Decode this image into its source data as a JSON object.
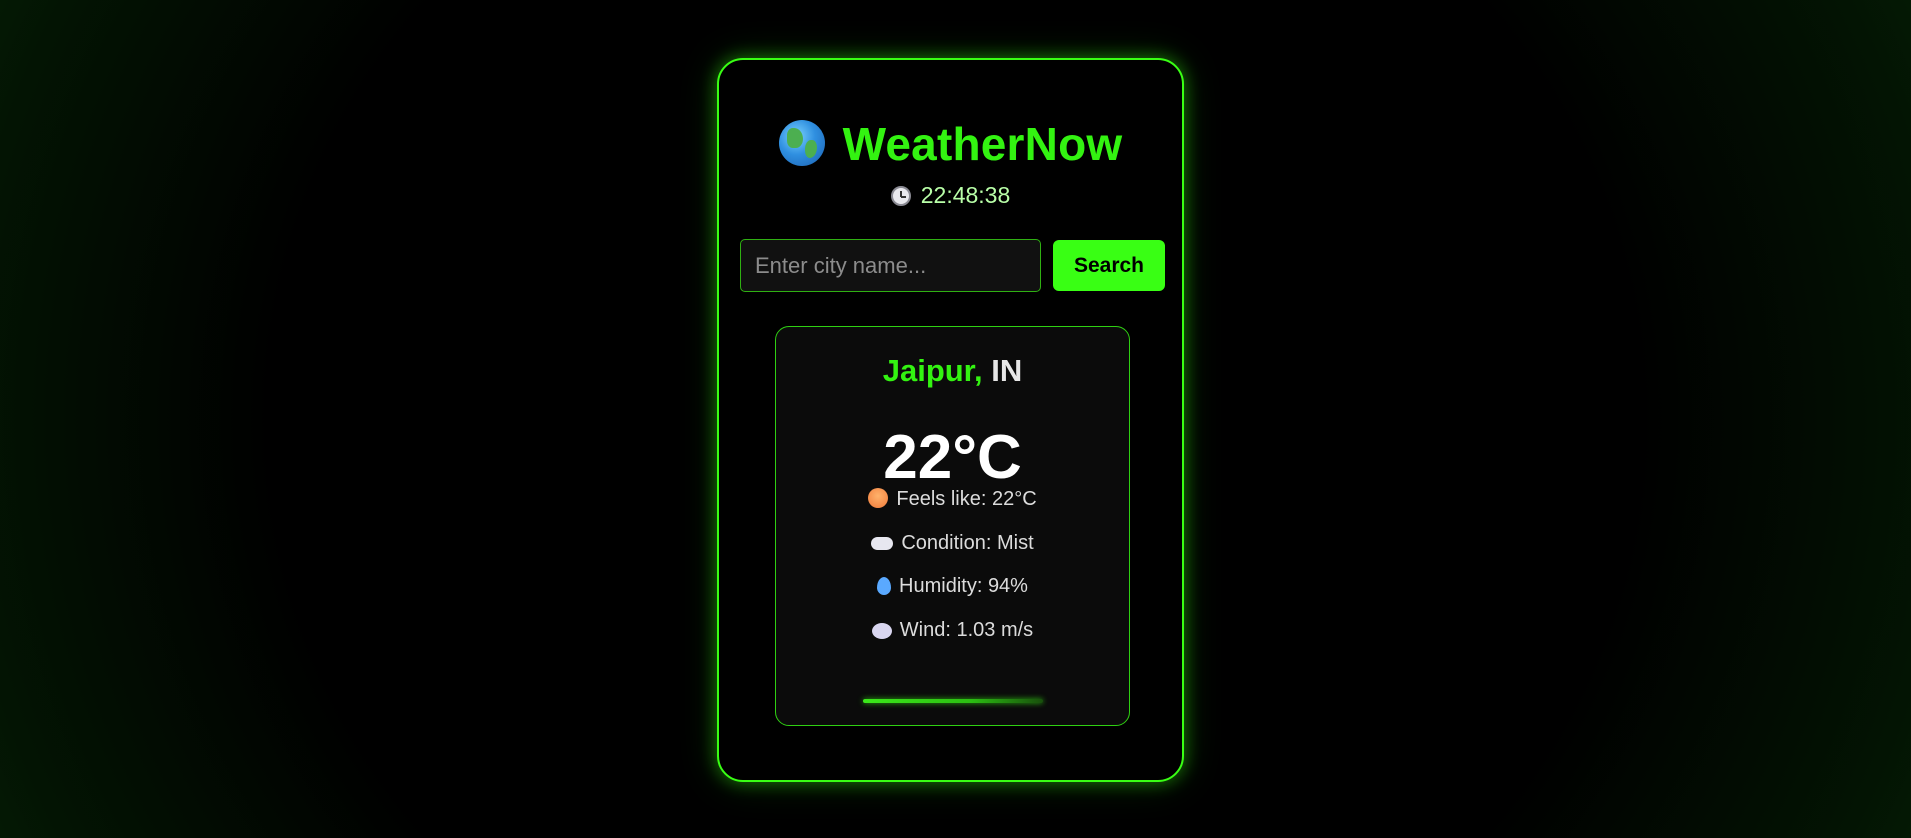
{
  "header": {
    "title": "WeatherNow",
    "time": "22:48:38",
    "globe_icon": "globe-icon",
    "clock_icon": "clock-icon"
  },
  "search": {
    "placeholder": "Enter city name...",
    "value": "",
    "button_label": "Search"
  },
  "weather": {
    "city": "Jaipur,",
    "country": "IN",
    "temperature": "22°C",
    "feels_like": "Feels like: 22°C",
    "condition": "Condition: Mist",
    "humidity": "Humidity: 94%",
    "wind": "Wind: 1.03 m/s"
  },
  "colors": {
    "accent": "#39ff14",
    "background": "#000000",
    "card": "#0b0b0b"
  }
}
